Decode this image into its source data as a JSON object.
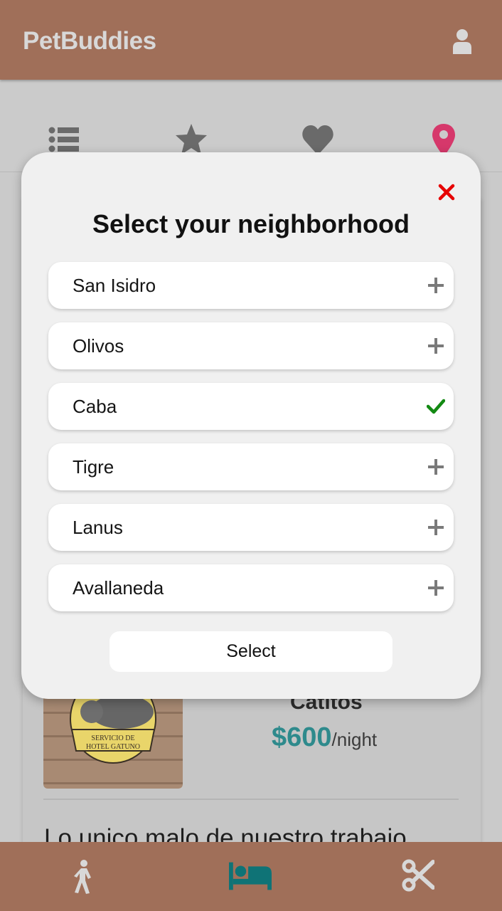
{
  "header": {
    "title": "PetBuddies",
    "user_icon": "user-icon"
  },
  "tabs": [
    {
      "icon": "list-icon",
      "active": false
    },
    {
      "icon": "star-icon",
      "active": false
    },
    {
      "icon": "heart-icon",
      "active": false
    },
    {
      "icon": "location-pin-icon",
      "active": true
    }
  ],
  "modal": {
    "title": "Select your neighborhood",
    "close_icon": "close-icon",
    "options": [
      {
        "label": "San Isidro",
        "selected": false
      },
      {
        "label": "Olivos",
        "selected": false
      },
      {
        "label": "Caba",
        "selected": true
      },
      {
        "label": "Tigre",
        "selected": false
      },
      {
        "label": "Lanus",
        "selected": false
      },
      {
        "label": "Avallaneda",
        "selected": false
      }
    ],
    "select_label": "Select"
  },
  "listing": {
    "image_text": "SERVICIO DE HOTEL GATUNO",
    "name": "Catitos",
    "price": "$600",
    "price_unit": "/night",
    "review_text": "Lo unico malo de nuestro trabajo"
  },
  "bottom_nav": [
    {
      "icon": "walk-icon",
      "active": false
    },
    {
      "icon": "bed-icon",
      "active": true
    },
    {
      "icon": "scissors-icon",
      "active": false
    }
  ],
  "colors": {
    "brand": "#a06f59",
    "active_tab": "#d6386b",
    "active_nav": "#0f7376",
    "price": "#2e8a8c",
    "close": "#e60000",
    "check": "#138a13"
  }
}
